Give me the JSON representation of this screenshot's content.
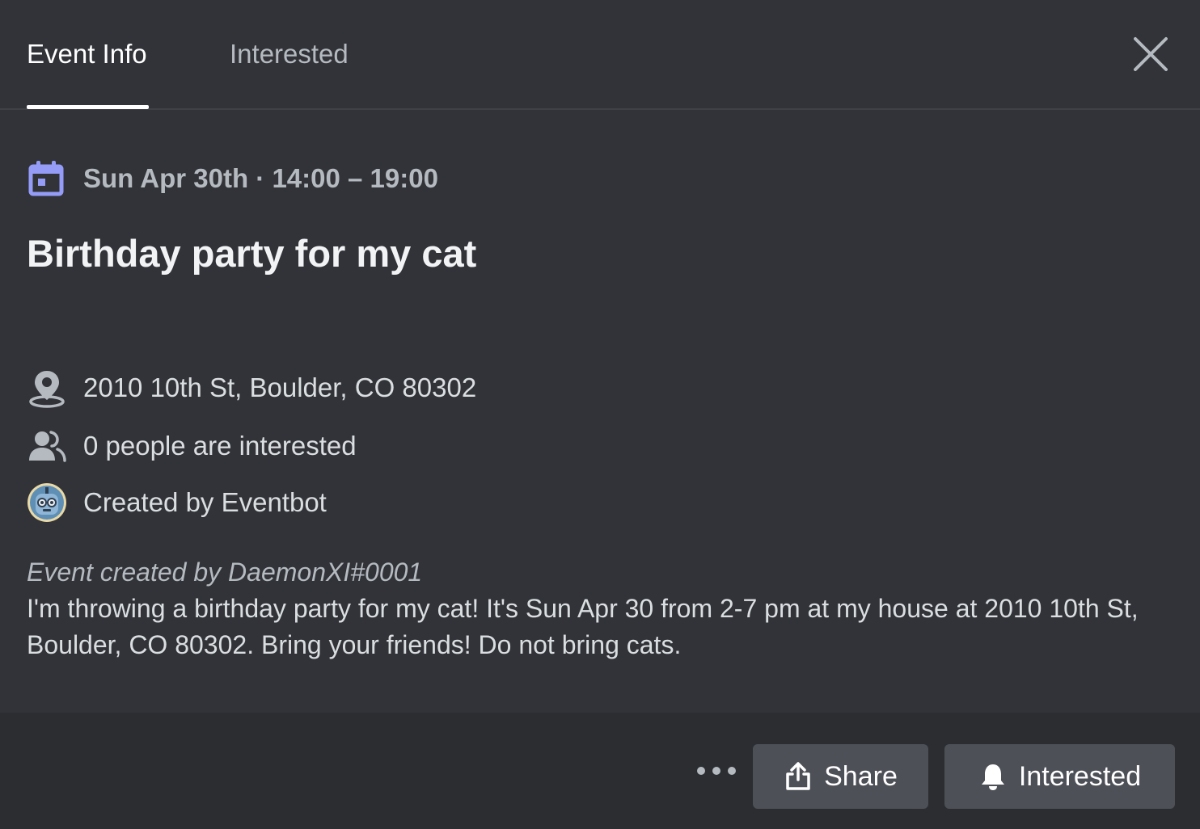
{
  "tabs": {
    "event_info": "Event Info",
    "interested": "Interested"
  },
  "event": {
    "date_time": "Sun Apr 30th · 14:00 – 19:00",
    "title": "Birthday party for my cat",
    "location": "2010 10th St, Boulder, CO 80302",
    "interested_count": "0 people are interested",
    "created_by": "Created by Eventbot",
    "description_credit": "Event created by DaemonXI#0001",
    "description": "I'm throwing a birthday party for my cat! It's Sun Apr 30 from 2-7 pm at my house at 2010 10th St, Boulder, CO 80302. Bring your friends! Do not bring cats."
  },
  "footer": {
    "share_label": "Share",
    "interested_label": "Interested"
  },
  "icons": {
    "close": "close-icon",
    "calendar": "calendar-icon",
    "location": "location-pin-icon",
    "people": "people-icon",
    "avatar": "eventbot-avatar",
    "more": "more-dots-icon",
    "share": "share-icon",
    "bell": "bell-icon"
  },
  "colors": {
    "background": "#313338",
    "footer_background": "#2b2d31",
    "accent_calendar": "#949cf7",
    "button_background": "#4e5058"
  }
}
